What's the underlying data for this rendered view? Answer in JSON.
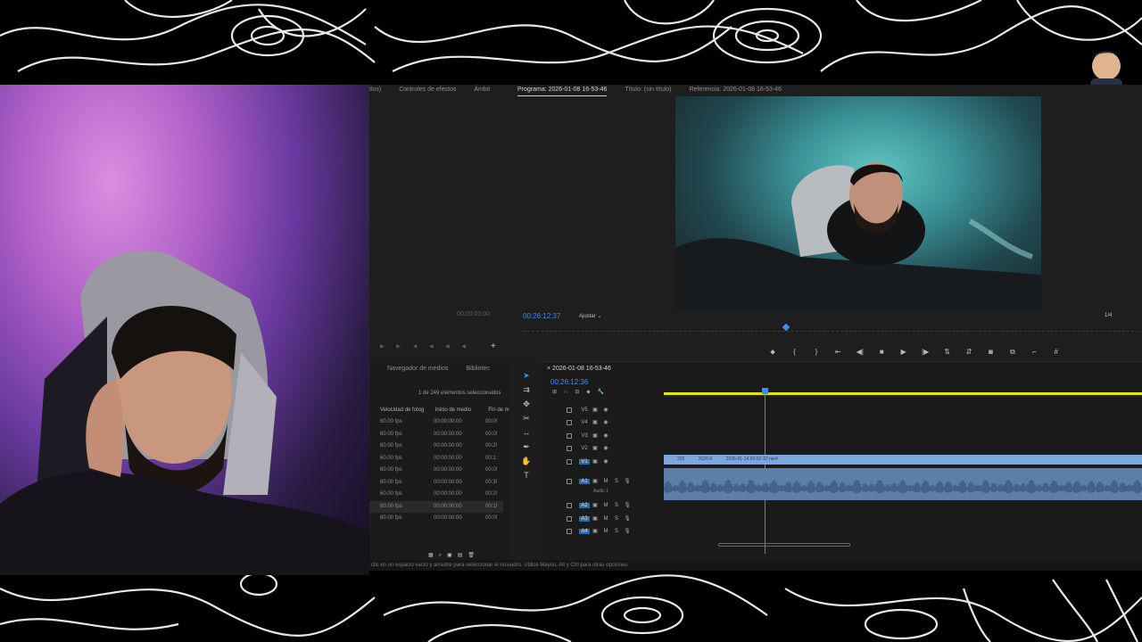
{
  "source_panel": {
    "tabs": [
      "tlos)",
      "Controles de efectos",
      "Ámbit"
    ],
    "timecode": "00;00;00;00"
  },
  "program_panel": {
    "tab": "Programa: 2026-01-08 16-53-46",
    "title_tab": "Título: (sin título)",
    "reference_tab": "Referencia: 2026-01-08 16-53-46",
    "timecode": "00:26:12:37",
    "fit": "Ajustar",
    "quality": "1/4",
    "controls": [
      "marker",
      "in",
      "out",
      "go-in",
      "step-back",
      "stop",
      "play",
      "step-forward",
      "lift",
      "extract",
      "export-frame",
      "insert",
      "overwrite",
      "settings"
    ]
  },
  "project_panel": {
    "tabs": [
      "Navegador de medios",
      "Bibliotec"
    ],
    "selection_info": "1 de 249 elementos seleccionados",
    "columns": [
      "Velocidad de fotog",
      "Inicio de medio",
      "Fin de m"
    ],
    "rows": [
      [
        "60.00 fps",
        "00:00:00:00",
        "00:0!"
      ],
      [
        "60.00 fps",
        "00:00:00:00",
        "00:0!"
      ],
      [
        "60.00 fps",
        "00:00:00:00",
        "00:2!"
      ],
      [
        "60.00 fps",
        "00:00:00:00",
        "00:1:"
      ],
      [
        "60.00 fps",
        "00:00:00:00",
        "00:0!"
      ],
      [
        "60.00 fps",
        "00:00:00:00",
        "00:3!"
      ],
      [
        "60.00 fps",
        "00:00:00:00",
        "00:2!"
      ],
      [
        "60.00 fps",
        "00:00:00:00",
        "00:1!"
      ],
      [
        "60.00 fps",
        "00:00:00:00",
        "00:0!"
      ]
    ]
  },
  "timeline": {
    "sequence_tab": "2026-01-08 16-53-46",
    "timecode": "00:26:12:36",
    "video_tracks": [
      "V5",
      "V4",
      "V3",
      "V2",
      "V1"
    ],
    "audio_tracks": [
      "A1",
      "A2",
      "A3",
      "A4"
    ],
    "audio1_name": "Audio 1",
    "clips": [
      "202",
      "2026-0",
      "2026-01-14 03-52-37.mp4"
    ]
  },
  "status_bar": "clic en un espacio vacío y arrastre para seleccionar el recuadro. Utilice Mayús, Alt y Ctrl para otras opciones.",
  "colors": {
    "accent": "#3d8df5",
    "clip_video": "#7fa6da",
    "clip_audio": "#5c7ea8",
    "yellow": "#e6e600"
  }
}
